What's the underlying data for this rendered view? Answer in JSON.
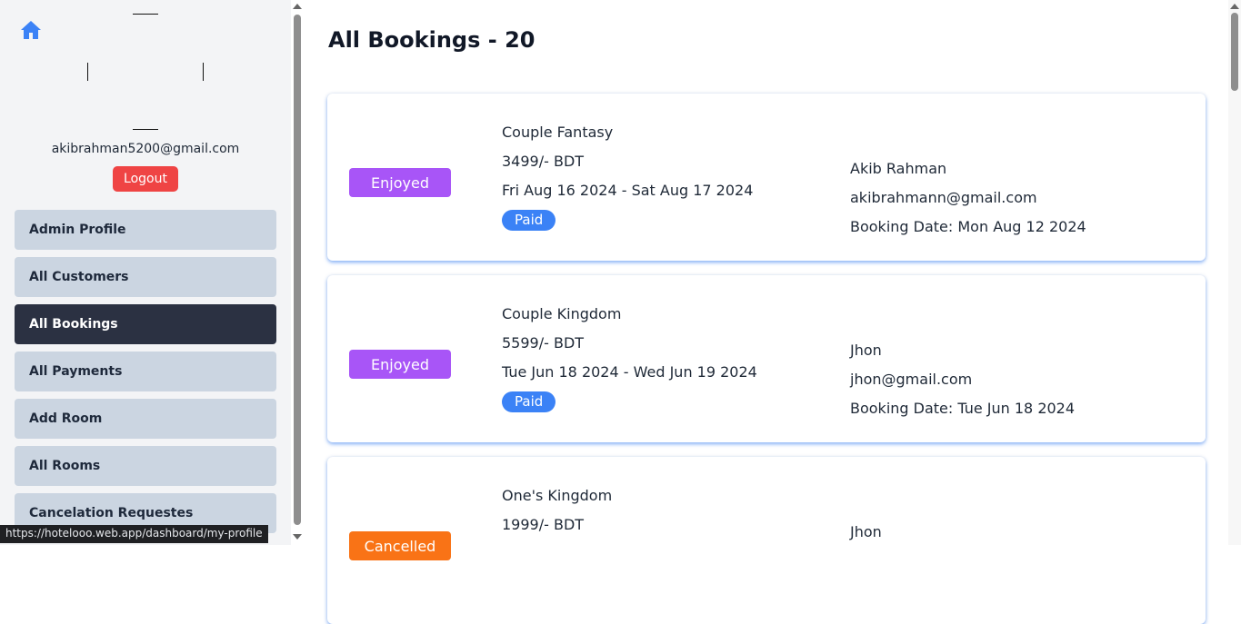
{
  "sidebar": {
    "user_email": "akibrahman5200@gmail.com",
    "logout_label": "Logout",
    "items": [
      {
        "label": "Admin Profile"
      },
      {
        "label": "All Customers"
      },
      {
        "label": "All Bookings",
        "active": true
      },
      {
        "label": "All Payments"
      },
      {
        "label": "Add Room"
      },
      {
        "label": "All Rooms"
      },
      {
        "label": "Cancelation Requestes"
      }
    ]
  },
  "statusbar": {
    "url": "https://hotelooo.web.app/dashboard/my-profile"
  },
  "main": {
    "title": "All Bookings - 20",
    "bookings": [
      {
        "status": "Enjoyed",
        "status_color": "#a855f7",
        "room": "Couple Fantasy",
        "price": "3499/- BDT",
        "dates": "Fri Aug 16 2024 - Sat Aug 17 2024",
        "payment": "Paid",
        "customer_name": "Akib Rahman",
        "customer_email": "akibrahmann@gmail.com",
        "booking_date": "Booking Date: Mon Aug 12 2024"
      },
      {
        "status": "Enjoyed",
        "status_color": "#a855f7",
        "room": "Couple Kingdom",
        "price": "5599/- BDT",
        "dates": "Tue Jun 18 2024 - Wed Jun 19 2024",
        "payment": "Paid",
        "customer_name": "Jhon",
        "customer_email": "jhon@gmail.com",
        "booking_date": "Booking Date: Tue Jun 18 2024"
      },
      {
        "status": "Cancelled",
        "status_color": "#f97316",
        "room": "One's Kingdom",
        "price": "1999/- BDT",
        "customer_name": "Jhon"
      }
    ]
  },
  "colors": {
    "accent": "#3b82f6",
    "danger": "#ef4444",
    "active_nav": "#2b3142",
    "nav_bg": "#cbd5e1"
  }
}
